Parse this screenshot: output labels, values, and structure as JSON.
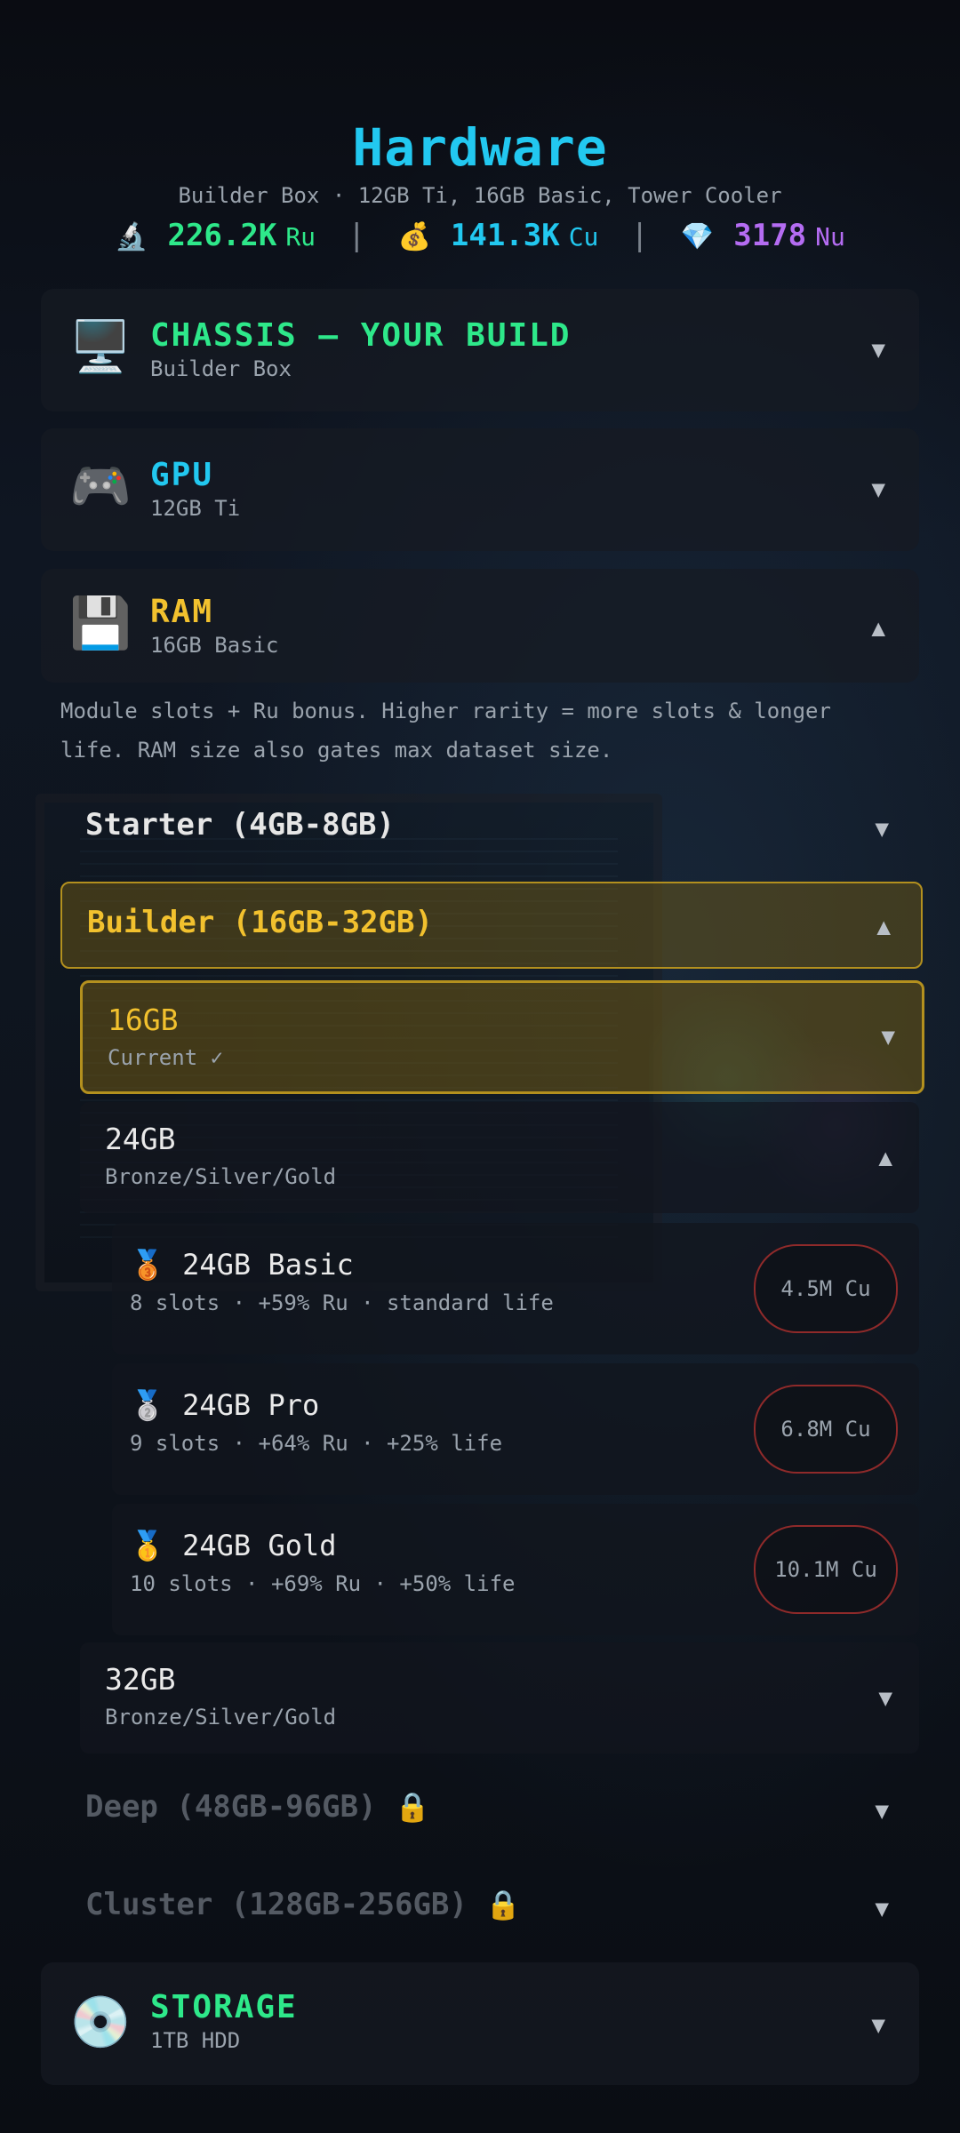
{
  "header": {
    "title": "Hardware",
    "subtitle": "Builder Box · 12GB Ti, 16GB Basic, Tower Cooler"
  },
  "currencies": [
    {
      "icon": "microscope-icon",
      "glyph": "🔬",
      "value": "226.2K",
      "unit": "Ru",
      "color": "#2ee88a"
    },
    {
      "icon": "money-bag-icon",
      "glyph": "💰",
      "value": "141.3K",
      "unit": "Cu",
      "color": "#22c8f0"
    },
    {
      "icon": "gem-icon",
      "glyph": "💎",
      "value": "3178",
      "unit": "Nu",
      "color": "#b46cf2"
    }
  ],
  "separator": "|",
  "sections": {
    "chassis": {
      "icon": "desktop-icon",
      "glyph": "🖥️",
      "title": "CHASSIS — YOUR BUILD",
      "sub": "Builder Box",
      "color": "#2ee88a"
    },
    "gpu": {
      "icon": "gamepad-icon",
      "glyph": "🎮",
      "title": "GPU",
      "sub": "12GB Ti",
      "color": "#22c8f0"
    },
    "ram": {
      "icon": "floppy-disk-icon",
      "glyph": "💾",
      "title": "RAM",
      "sub": "16GB Basic",
      "color": "#f2c12e"
    },
    "storage": {
      "icon": "disc-icon",
      "glyph": "💿",
      "title": "STORAGE",
      "sub": "1TB HDD",
      "color": "#2ee88a"
    }
  },
  "ram": {
    "description": "Module slots + Ru bonus. Higher rarity = more slots & longer life. RAM size also gates max dataset size.",
    "tiers": {
      "starter": "Starter (4GB-8GB)",
      "builder": "Builder (16GB-32GB)",
      "deep": "Deep (48GB-96GB)",
      "cluster": "Cluster (128GB-256GB)"
    },
    "sizes": {
      "s16": {
        "name": "16GB",
        "sub": "Current ✓"
      },
      "s24": {
        "name": "24GB",
        "sub": "Bronze/Silver/Gold"
      },
      "s32": {
        "name": "32GB",
        "sub": "Bronze/Silver/Gold"
      }
    },
    "options": [
      {
        "medal": "🥉",
        "name": "24GB Basic",
        "sub": "8 slots · +59% Ru · standard life",
        "price": "4.5M Cu"
      },
      {
        "medal": "🥈",
        "name": "24GB Pro",
        "sub": "9 slots · +64% Ru · +25% life",
        "price": "6.8M Cu"
      },
      {
        "medal": "🥇",
        "name": "24GB Gold",
        "sub": "10 slots · +69% Ru · +50% life",
        "price": "10.1M Cu"
      }
    ]
  },
  "icons": {
    "chevron_down": "▼",
    "chevron_up": "▲",
    "lock": "🔒"
  },
  "colors": {
    "accent_cyan": "#22c8f0",
    "accent_green": "#2ee88a",
    "accent_gold": "#f2c12e",
    "accent_purple": "#b46cf2",
    "price_border": "#8f2a2a"
  }
}
